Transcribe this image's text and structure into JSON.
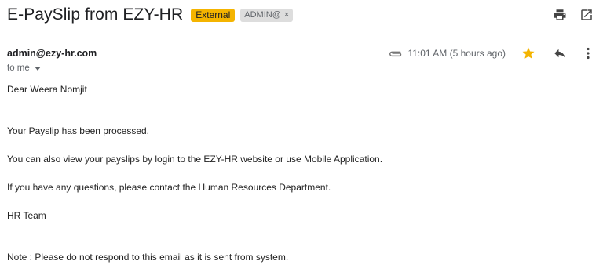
{
  "subject": {
    "title": "E-PaySlip from EZY-HR",
    "label_external": "External",
    "label_admin": "ADMIN@",
    "label_admin_remove": "×"
  },
  "toolbar": {
    "icons": [
      "print-icon",
      "open-in-new-window-icon"
    ]
  },
  "message": {
    "sender": "admin@ezy-hr.com",
    "recipient": "to me",
    "timestamp": "11:01 AM (5 hours ago)",
    "icons": [
      "attachment-icon",
      "star-icon",
      "reply-icon",
      "more-vertical-icon"
    ],
    "star_color": "#f4b400"
  },
  "body": {
    "greeting": "Dear Weera Nomjit",
    "line1": "Your Payslip has been processed.",
    "line2": "You can also view your payslips by login to the EZY-HR website or use Mobile Application.",
    "line3": "If you have any questions, please contact the Human Resources Department.",
    "signature": "HR Team",
    "note": "Note : Please do not respond to this email as it is sent from system."
  }
}
